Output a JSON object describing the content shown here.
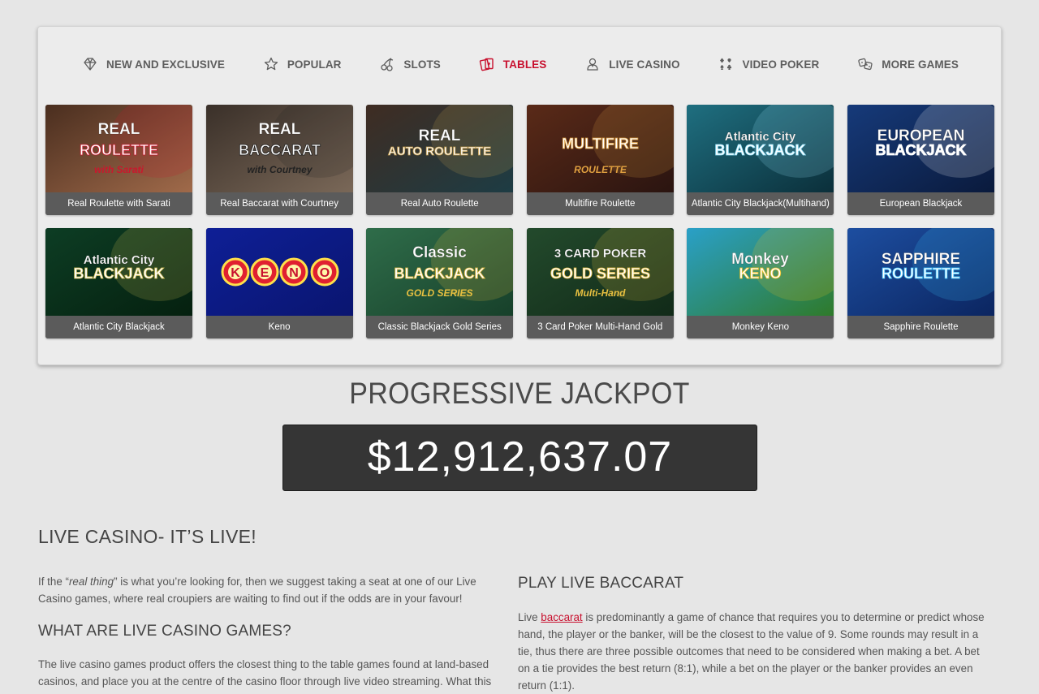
{
  "nav": [
    {
      "label": "NEW AND EXCLUSIVE",
      "icon": "diamond-icon",
      "active": false
    },
    {
      "label": "POPULAR",
      "icon": "star-icon",
      "active": false
    },
    {
      "label": "SLOTS",
      "icon": "cherries-icon",
      "active": false
    },
    {
      "label": "TABLES",
      "icon": "cards-icon",
      "active": true
    },
    {
      "label": "LIVE CASINO",
      "icon": "dealer-icon",
      "active": false
    },
    {
      "label": "VIDEO POKER",
      "icon": "card-suits-icon",
      "active": false
    },
    {
      "label": "MORE GAMES",
      "icon": "dice-icon",
      "active": false
    }
  ],
  "games": [
    {
      "name": "Real Roulette with Sarati",
      "art": [
        "REAL",
        "ROULETTE",
        "with Sarati"
      ],
      "bg": [
        "#4a2e1f",
        "#a06a4a"
      ],
      "accent": "#c9182d"
    },
    {
      "name": "Real Baccarat with Courtney",
      "art": [
        "REAL",
        "BACCARAT",
        "with Courtney"
      ],
      "bg": [
        "#3a3029",
        "#7a6858"
      ],
      "accent": "#222222"
    },
    {
      "name": "Real Auto Roulette",
      "art": [
        "REAL",
        "AUTO ROULETTE",
        ""
      ],
      "bg": [
        "#3f2c22",
        "#1d3c44"
      ],
      "accent": "#c8a050"
    },
    {
      "name": "Multifire Roulette",
      "art": [
        "",
        "MULTIFIRE",
        "ROULETTE"
      ],
      "bg": [
        "#5a2a18",
        "#2a1410"
      ],
      "accent": "#e0a040"
    },
    {
      "name": "Atlantic City Blackjack(Multihand)",
      "art": [
        "Atlantic City",
        "BLACKJACK",
        ""
      ],
      "bg": [
        "#1f6f80",
        "#0b2f3a"
      ],
      "accent": "#9de7ff"
    },
    {
      "name": "European Blackjack",
      "art": [
        "EUROPEAN",
        "BLACKJACK",
        ""
      ],
      "bg": [
        "#163a7a",
        "#0a1a3c"
      ],
      "accent": "#ffffff"
    },
    {
      "name": "Atlantic City Blackjack",
      "art": [
        "Atlantic City",
        "BLACKJACK",
        ""
      ],
      "bg": [
        "#0d3d24",
        "#05200f"
      ],
      "accent": "#d8c55a"
    },
    {
      "name": "Keno",
      "art": [
        "K",
        "E",
        "N",
        "O"
      ],
      "bg": [
        "#0e1f96",
        "#0a1570"
      ],
      "accent": "#e02030"
    },
    {
      "name": "Classic Blackjack Gold Series",
      "art": [
        "Classic",
        "BLACKJACK",
        "GOLD SERIES"
      ],
      "bg": [
        "#2f6d4a",
        "#17402a"
      ],
      "accent": "#e8c040"
    },
    {
      "name": "3 Card Poker Multi-Hand Gold",
      "art": [
        "3 CARD POKER",
        "GOLD SERIES",
        "Multi-Hand"
      ],
      "bg": [
        "#234a2c",
        "#112a18"
      ],
      "accent": "#e8c040"
    },
    {
      "name": "Monkey Keno",
      "art": [
        "Monkey",
        "KENO",
        ""
      ],
      "bg": [
        "#2aa0c8",
        "#2f7a2a"
      ],
      "accent": "#f0c020"
    },
    {
      "name": "Sapphire Roulette",
      "art": [
        "SAPPHIRE",
        "ROULETTE",
        ""
      ],
      "bg": [
        "#1d4ea0",
        "#0b2560"
      ],
      "accent": "#3fc6ff"
    }
  ],
  "jackpot": {
    "title": "PROGRESSIVE JACKPOT",
    "amount": "$12,912,637.07"
  },
  "content": {
    "heading": "LIVE CASINO- IT’S LIVE!",
    "intro_before": "If the “",
    "intro_em": "real thing",
    "intro_after": "” is what you’re looking for, then we suggest taking a seat at one of our Live Casino games, where real croupiers are waiting to find out if the odds are in your favour!",
    "what_heading": "WHAT ARE LIVE CASINO GAMES?",
    "what_body": "The live casino games product offers the closest thing to the table games found at land-based casinos, and place you at the centre of the casino floor through live video streaming. What this",
    "baccarat_heading": "PLAY LIVE BACCARAT",
    "baccarat_before": "Live ",
    "baccarat_link": "baccarat",
    "baccarat_after": " is predominantly a game of chance that requires you to determine or predict whose hand, the player or the banker, will be the closest to the value of 9. Some rounds may result in a tie, thus there are three possible outcomes that need to be considered when making a bet. A bet on a tie provides the best return (8:1), while a bet on the player or the banker provides an even return (1:1)."
  },
  "colors": {
    "accent": "#c8102e",
    "nav_text": "#5d5d5d",
    "jackpot_bg": "#353535"
  }
}
